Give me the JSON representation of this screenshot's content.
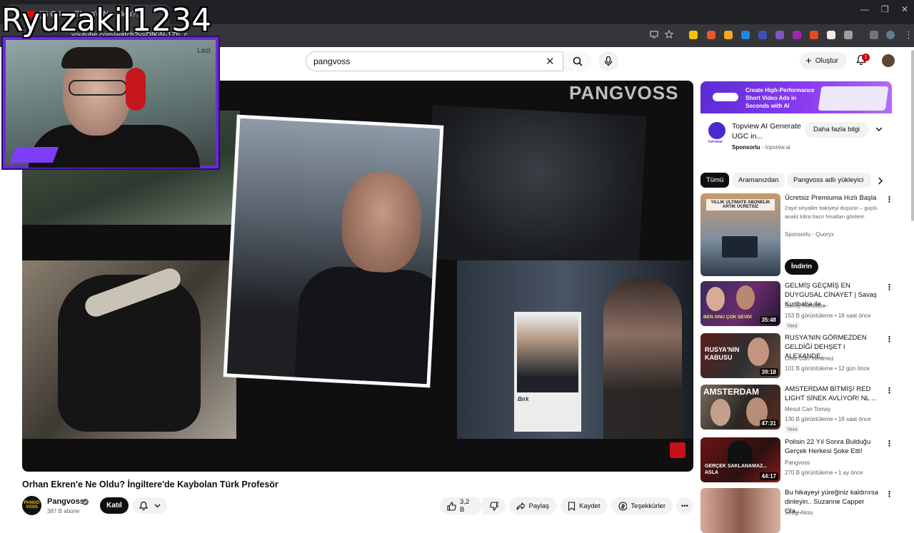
{
  "browser": {
    "tab_title": "(1) Orhan Ekren'e Ne Oldu?...",
    "url": "youtube.com/watch?v=DfKiN-1Zh_c",
    "window_controls": [
      "—",
      "❐",
      "✕"
    ]
  },
  "header": {
    "search_value": "pangvoss",
    "create_label": "Oluştur",
    "notification_count": "1"
  },
  "player": {
    "overlay_brand": "PANGVOSS",
    "id_card_text": "Birk"
  },
  "video": {
    "title": "Orhan Ekren'e Ne Oldu? İngiltere'de Kaybolan Türk Profesör",
    "channel_name": "Pangvoss",
    "channel_avatar_text": "PANGO VOSS",
    "subscribers": "387 B abone",
    "join_label": "Katıl",
    "like_count": "3,2 B",
    "share_label": "Paylaş",
    "save_label": "Kaydet",
    "thanks_label": "Teşekkürler"
  },
  "sidebar": {
    "ad": {
      "banner_text": "Create High-Performance Short Video Ads in Seconds with AI",
      "brand_mark": "TOPVIEW",
      "title": "Topview AI Generate UGC in...",
      "sponsored": "Sponsorlu",
      "domain": "topview.ai",
      "cta": "Daha fazla bilgi"
    },
    "chips": [
      "Tümü",
      "Aramanızdan",
      "Pangvoss adlı yükleyici"
    ],
    "recommendations": [
      {
        "title": "Ücretsiz Premiuma Hızlı Başla",
        "desc": "Zayıf sinyaller bakiyeyi düşürür – güçlü analiz kâra hazır fırsatları gösterir.",
        "channel": "Sponsorlu · Quoryx",
        "views": "",
        "badge": "",
        "duration": "",
        "thumb_text": "YILLIK ULTIMATE ABONELİK ARTIK ÜCRETSİZ",
        "cta": "İndirin"
      },
      {
        "title": "GELMİŞ GEÇMİŞ EN DUYGUSAL CİNAYET | Savaş Kurtbaba ile ...",
        "channel": "Savaş Kurtbaba",
        "views": "153 B görüntüleme • 18 saat önce",
        "badge": "Yeni",
        "duration": "35:48",
        "thumb_text": "BEN ONU ÇOK SEVDİ"
      },
      {
        "title": "RUSYA'NIN GÖRMEZDEN GELDİĞİ DEHŞET l ALEXANDE...",
        "channel": "Onur Can Yenilmez",
        "views": "101 B görüntüleme • 12 gün önce",
        "badge": "",
        "duration": "39:18",
        "thumb_text": "RUSYA'NIN KABUSU"
      },
      {
        "title": "AMSTERDAM BİTMİŞ! RED LIGHT SİNEK AVLIYOR! NL ...",
        "channel": "Mesut Can Tomay",
        "views": "130 B görüntüleme • 18 saat önce",
        "badge": "Yeni",
        "duration": "47:31",
        "thumb_text": "AMSTERDAM"
      },
      {
        "title": "Polisin 22 Yıl Sonra Bulduğu Gerçek Herkesi Şoke Etti!",
        "channel": "Pangvoss",
        "views": "270 B görüntüleme • 1 ay önce",
        "badge": "",
        "duration": "44:17",
        "thumb_text": "GERÇEK SAKLANAMAZ... ASLA"
      },
      {
        "title": "Bu hikayeyi yüreğiniz kaldırırsa dinleyin.. Suzanne Capper Ola...",
        "channel": "Sezgi Aksu",
        "views": "",
        "badge": "",
        "duration": "",
        "thumb_text": ""
      }
    ]
  },
  "overlay": {
    "streamer_name": "Ryuzakil1234",
    "last_label": "Last"
  },
  "colors": {
    "accent": "#ff0000",
    "stream_frame": "#6a2ad7"
  }
}
